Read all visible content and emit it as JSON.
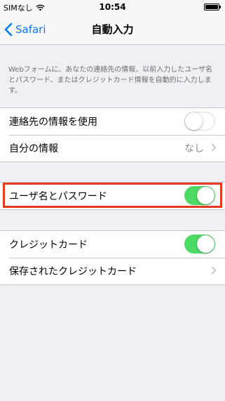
{
  "status_bar": {
    "carrier": "SIMなし",
    "time": "10:54"
  },
  "nav": {
    "back_label": "Safari",
    "title": "自動入力"
  },
  "description": "Webフォームに、あなたの連絡先の情報、以前入力したユーザ名とパスワード、またはクレジットカード情報を自動的に入力します。",
  "group1": {
    "use_contact_label": "連絡先の情報を使用",
    "use_contact_on": false,
    "my_info_label": "自分の情報",
    "my_info_value": "なし"
  },
  "group2": {
    "names_passwords_label": "ユーザ名とパスワード",
    "names_passwords_on": true
  },
  "group3": {
    "credit_cards_label": "クレジットカード",
    "credit_cards_on": true,
    "saved_cards_label": "保存されたクレジットカード"
  },
  "colors": {
    "accent": "#007aff",
    "toggle_on": "#4cd964",
    "highlight": "#e53a22"
  }
}
